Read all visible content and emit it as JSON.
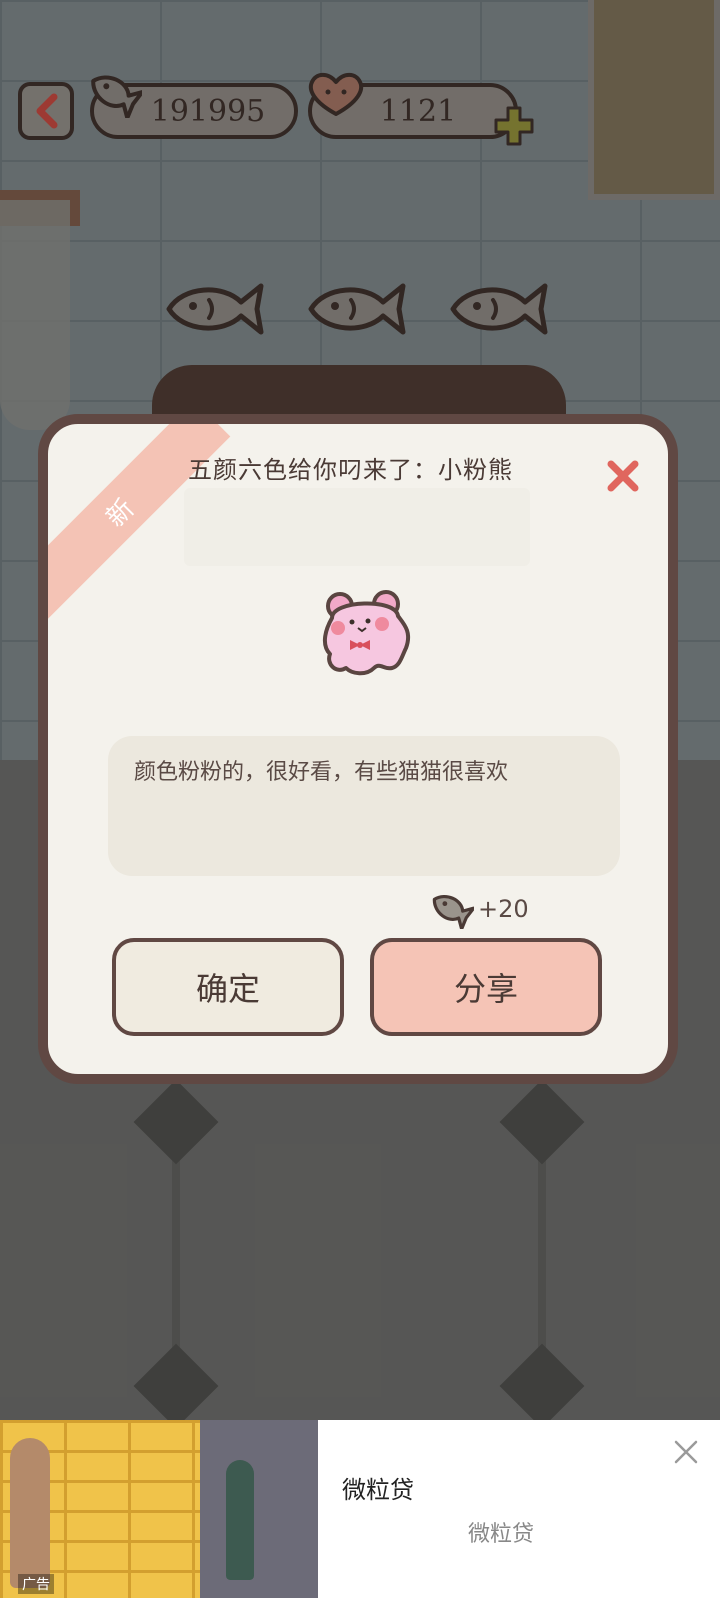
{
  "top_bar": {
    "fish_count": "191995",
    "heart_count": "1121"
  },
  "dialog": {
    "badge": "新",
    "title": "五颜六色给你叼来了：小粉熊",
    "description": "颜色粉粉的，很好看，有些猫猫很喜欢",
    "reward": "+20",
    "confirm_label": "确定",
    "share_label": "分享"
  },
  "ad": {
    "label": "广告",
    "title": "微粒贷",
    "subtitle": "微粒贷"
  },
  "colors": {
    "dialog_border": "#604843",
    "share_button": "#f5c4b6",
    "close_x": "#e0665e",
    "ribbon": "#f4c3b5"
  }
}
